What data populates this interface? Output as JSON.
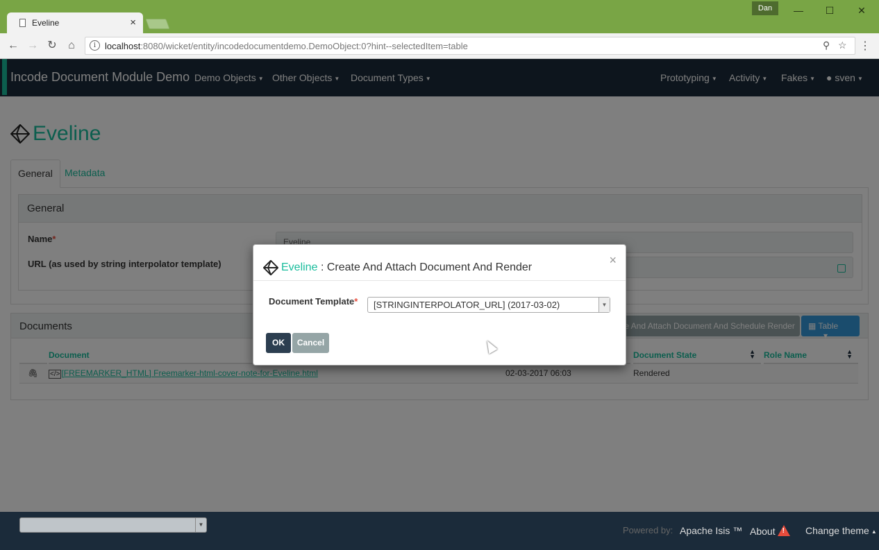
{
  "browser": {
    "tab_title": "Eveline",
    "user_badge": "Dan",
    "url_host": "localhost",
    "url_rest": ":8080/wicket/entity/incodedocumentdemo.DemoObject:0?hint--selectedItem=table"
  },
  "navbar": {
    "brand": "Incode Document Module Demo",
    "menus_left": [
      "Demo Objects",
      "Other Objects",
      "Document Types"
    ],
    "menus_right": [
      "Prototyping",
      "Activity",
      "Fakes",
      "sven"
    ]
  },
  "entity": {
    "title": "Eveline",
    "tabs": [
      "General",
      "Metadata"
    ],
    "panel_title": "General",
    "fields": [
      {
        "label": "Name",
        "required": "*",
        "value": "Eveline"
      },
      {
        "label": "URL (as used by string interpolator template)",
        "value": ""
      }
    ]
  },
  "documents": {
    "title": "Documents",
    "action_button": "te And Attach Document And Schedule Render",
    "view_button": "Table",
    "columns": [
      "Document",
      "Document State",
      "Role Name"
    ],
    "rows": [
      {
        "document": "[FREEMARKER_HTML] Freemarker-html-cover-note-for-Eveline.html",
        "date": "02-03-2017 06:03",
        "state": "Rendered",
        "role": ""
      }
    ]
  },
  "modal": {
    "entity": "Eveline",
    "action": ": Create And Attach Document And Render",
    "close": "×",
    "field_label": "Document Template",
    "required": "*",
    "selected": "[STRINGINTERPOLATOR_URL] (2017-03-02)",
    "ok": "OK",
    "cancel": "Cancel"
  },
  "footer": {
    "powered_by": "Powered by:",
    "apache_isis": "Apache Isis ™",
    "about": "About",
    "change_theme": "Change theme"
  }
}
